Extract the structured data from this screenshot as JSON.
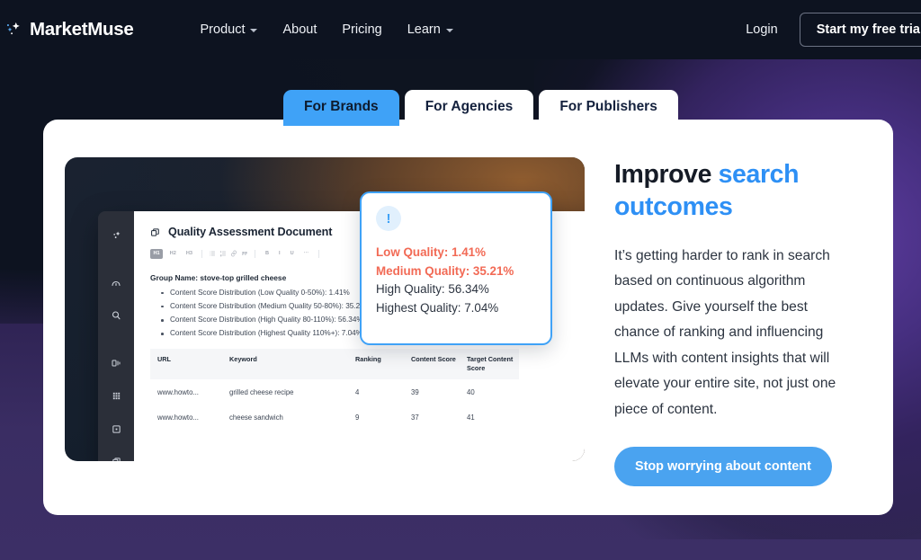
{
  "theme": {
    "accent_blue": "#3fa2f7",
    "cta_blue": "#4aa3f0",
    "alert_red": "#f26a55",
    "dark_navy": "#0d1320",
    "purple": "#3a2d63"
  },
  "navbar": {
    "brand": "MarketMuse",
    "brand_icon": "sparkle-icon",
    "links": [
      {
        "label": "Product",
        "has_caret": true
      },
      {
        "label": "About",
        "has_caret": false
      },
      {
        "label": "Pricing",
        "has_caret": false
      },
      {
        "label": "Learn",
        "has_caret": true
      }
    ],
    "login_label": "Login",
    "trial_label": "Start my free trial"
  },
  "tabs": [
    {
      "label": "For Brands",
      "active": true
    },
    {
      "label": "For Agencies",
      "active": false
    },
    {
      "label": "For Publishers",
      "active": false
    }
  ],
  "hero": {
    "heading_part1": "Improve ",
    "heading_part2": "search outcomes",
    "paragraph": "It’s getting harder to rank in search based on continuous algorithm updates. Give yourself the best chance of ranking and influencing LLMs with content insights that will elevate your entire site, not just one piece of content.",
    "cta_label": "Stop worrying about content"
  },
  "app_screenshot": {
    "sidebar_icons": [
      "sparkle-icon",
      "gauge-icon",
      "search-icon",
      "chart-bars-icon",
      "grid-icon",
      "square-dot-icon",
      "copy-icon"
    ],
    "document": {
      "title": "Quality Assessment Document",
      "title_icon": "document-copy-icon",
      "toolbar": {
        "heading_chips": [
          "H1",
          "H2",
          "H3"
        ],
        "active_chip": "H1",
        "icons": [
          "bulleted-list-icon",
          "numbered-list-icon",
          "link-icon",
          "quote-icon",
          "bold-icon",
          "italic-icon",
          "underline-icon",
          "more-icon"
        ]
      },
      "group_name": "Group Name: stove-top grilled cheese",
      "bullets": [
        "Content Score Distribution (Low Quality 0-50%): 1.41%",
        "Content Score Distribution (Medium Quality 50-80%): 35.21%",
        "Content Score Distribution (High Quality 80-110%): 56.34%",
        "Content Score Distribution (Highest Quality 110%+): 7.04%"
      ],
      "table": {
        "columns": [
          "URL",
          "Keyword",
          "Ranking",
          "Content Score",
          "Target Content Score"
        ],
        "rows": [
          [
            "www.howto...",
            "grilled cheese recipe",
            "4",
            "39",
            "40"
          ],
          [
            "www.howto...",
            "cheese sandwich",
            "9",
            "37",
            "41"
          ]
        ]
      }
    },
    "callout": {
      "badge_icon": "exclamation-icon",
      "badge_glyph": "!",
      "lines": [
        {
          "text": "Low Quality: 1.41%",
          "alert": true
        },
        {
          "text": "Medium Quality: 35.21%",
          "alert": true
        },
        {
          "text": "High Quality: 56.34%",
          "alert": false
        },
        {
          "text": "Highest Quality: 7.04%",
          "alert": false
        }
      ]
    }
  }
}
